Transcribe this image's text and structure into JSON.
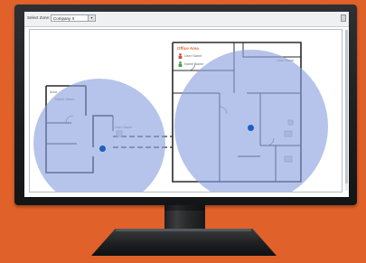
{
  "toolbar": {
    "zone_label": "Select Zone:",
    "zone_value": "Company X",
    "zone_dropdown_arrow": "▾"
  },
  "map": {
    "office_area_title": "Office Area",
    "users": [
      "User Name",
      "Name Name"
    ],
    "labels": {
      "left_room": "Area",
      "left_user": "Name Name",
      "center_user": "User Name",
      "right_user": "User Name"
    }
  },
  "icons": {
    "print": "print-icon",
    "person": "person-icon",
    "access_point": "access-point-icon"
  },
  "colors": {
    "background": "#e1612a",
    "coverage": "#899fde",
    "access_point": "#1f5fbf",
    "area_title": "#e1612a"
  }
}
